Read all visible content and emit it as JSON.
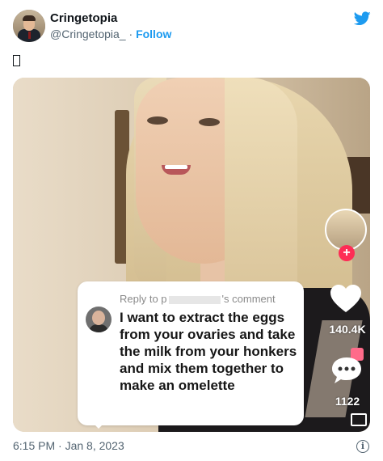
{
  "tweet": {
    "author_name": "Cringetopia",
    "author_handle": "@Cringetopia_",
    "separator": "·",
    "follow_label": "Follow",
    "timestamp": "6:15 PM · Jan 8, 2023",
    "info_glyph": "i"
  },
  "media": {
    "reply_header_prefix": "Reply to p",
    "reply_header_suffix": "'s comment",
    "comment_text": "I want to extract the eggs from your ovaries and take the milk from your honkers and mix them together to make an omelette",
    "likes_count": "140.4K",
    "comments_count": "1122",
    "follow_plus": "+"
  },
  "colors": {
    "brand_blue": "#1d9bf0",
    "tiktok_red": "#fe2c55",
    "text_secondary": "#536471"
  },
  "icons": [
    "twitter-bird-icon",
    "info-icon",
    "heart-icon",
    "comment-bubble-icon",
    "gift-icon",
    "image-icon",
    "plus-icon",
    "missing-glyph-icon"
  ]
}
